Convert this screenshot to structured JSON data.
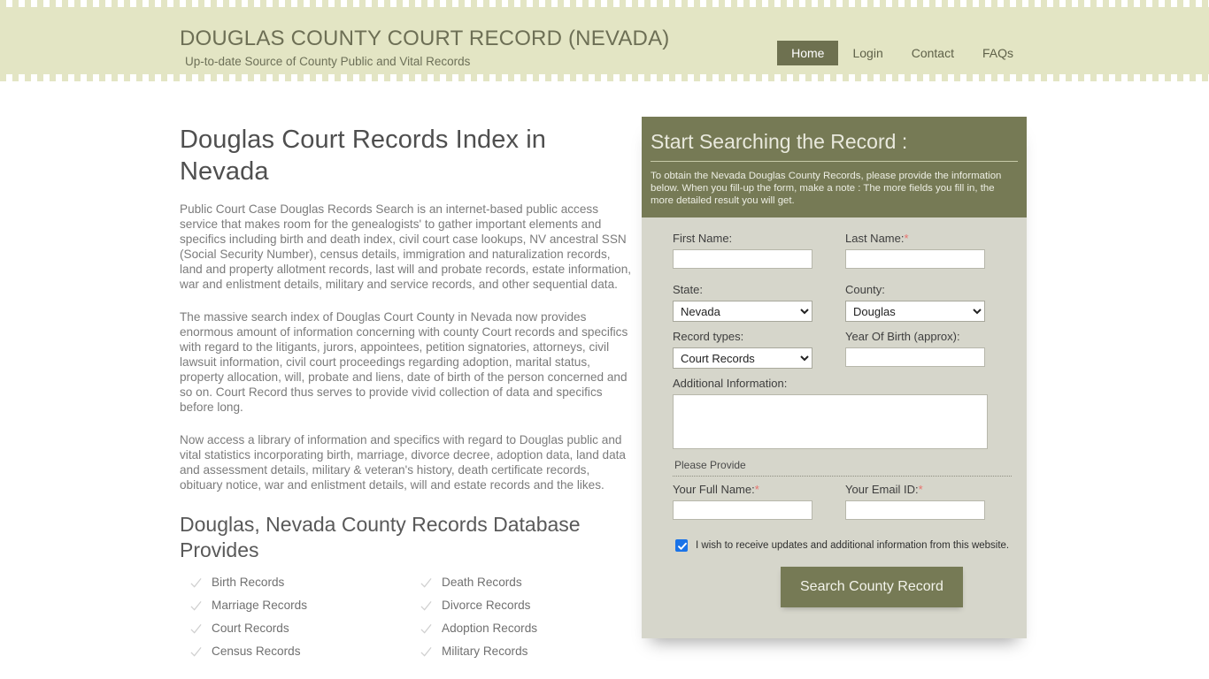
{
  "header": {
    "title": "DOUGLAS COUNTY COURT RECORD (NEVADA)",
    "subtitle": "Up-to-date Source of  County Public and Vital Records",
    "nav": [
      {
        "label": "Home",
        "active": true
      },
      {
        "label": "Login",
        "active": false
      },
      {
        "label": "Contact",
        "active": false
      },
      {
        "label": "FAQs",
        "active": false
      }
    ]
  },
  "content": {
    "page_title": "Douglas Court Records Index in Nevada",
    "paragraphs": [
      "Public Court Case Douglas Records Search is an internet-based public access service that makes room for the genealogists' to gather important elements and specifics including birth and death index, civil court case lookups, NV ancestral SSN (Social Security Number), census details, immigration and naturalization records, land and property allotment records, last will and probate records, estate information, war and enlistment details, military and service records, and other sequential data.",
      "The massive search index of Douglas Court County in Nevada now provides enormous amount of information concerning with county Court records and specifics with regard to the litigants, jurors, appointees, petition signatories, attorneys, civil lawsuit information, civil court proceedings regarding adoption, marital status, property allocation, will, probate and liens, date of birth of the person concerned and so on. Court Record thus serves to provide vivid collection of data and specifics before long.",
      "Now access a library of information and specifics with regard to Douglas public and vital statistics incorporating birth, marriage, divorce decree, adoption data, land data and assessment details, military & veteran's history, death certificate records, obituary notice, war and enlistment details, will and estate records and the likes."
    ],
    "section_title": "Douglas, Nevada County Records Database Provides",
    "records": [
      "Birth Records",
      "Death Records",
      "Marriage Records",
      "Divorce Records",
      "Court Records",
      "Adoption Records",
      "Census Records",
      "Military Records"
    ]
  },
  "search_panel": {
    "title": "Start Searching the Record :",
    "description": "To obtain the Nevada Douglas County Records, please provide the information below. When you fill-up the form, make a note : The more fields you fill in, the more detailed result you will get.",
    "fields": {
      "first_name_label": "First Name:",
      "first_name_value": "",
      "last_name_label": "Last Name:",
      "last_name_required": "*",
      "last_name_value": "",
      "state_label": "State:",
      "state_value": "Nevada",
      "state_options": [
        "Nevada"
      ],
      "county_label": "County:",
      "county_value": "Douglas",
      "county_options": [
        "Douglas"
      ],
      "record_types_label": "Record types:",
      "record_types_value": "Court Records",
      "record_types_options": [
        "Court Records"
      ],
      "year_of_birth_label": "Year Of Birth (approx):",
      "year_of_birth_value": "",
      "additional_info_label": "Additional Information:",
      "additional_info_value": "",
      "provide_note": "Please Provide",
      "full_name_label": "Your Full Name:",
      "full_name_required": "*",
      "full_name_value": "",
      "email_label": "Your Email ID:",
      "email_required": "*",
      "email_value": ""
    },
    "consent_text": "I wish to receive updates and additional information from this website.",
    "consent_checked": true,
    "submit_label": "Search County Record"
  },
  "colors": {
    "header_bg": "#e3e5c4",
    "accent_olive": "#767a55",
    "panel_bg": "#d6d6cb",
    "checkbox_blue": "#1a73e8",
    "required_red": "#e8726d"
  }
}
